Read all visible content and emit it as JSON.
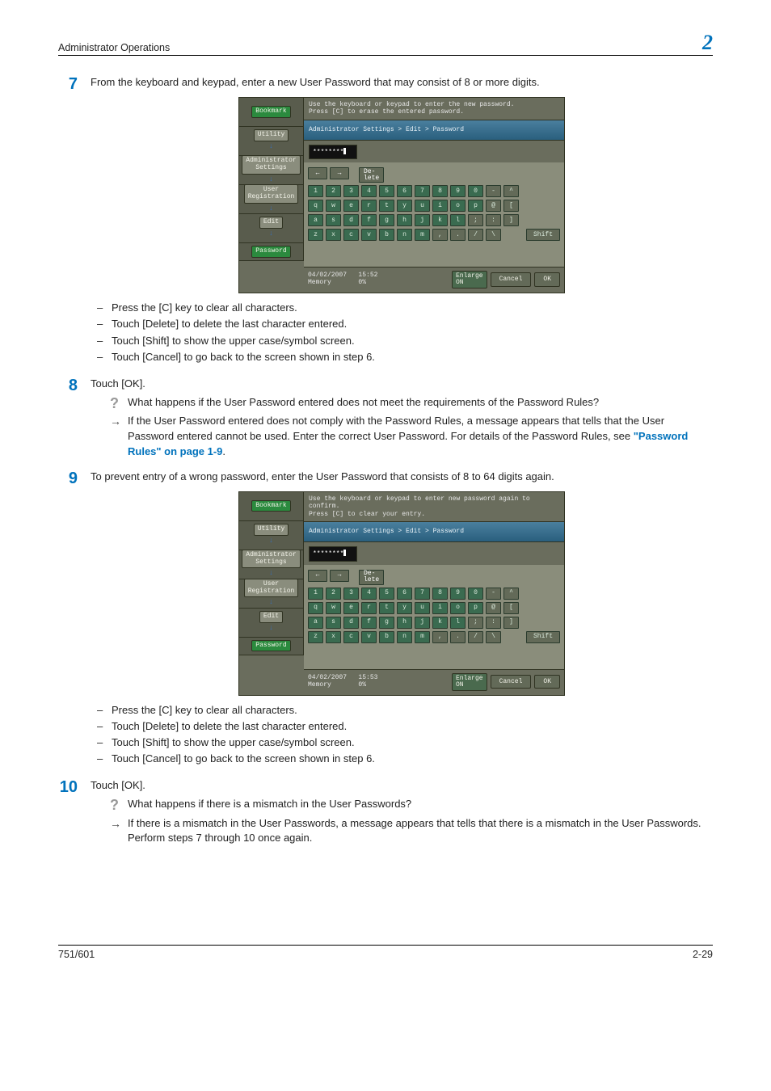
{
  "header": {
    "title": "Administrator Operations",
    "chapter": "2"
  },
  "footer": {
    "left": "751/601",
    "right": "2-29"
  },
  "steps": {
    "s7": {
      "num": "7",
      "text": "From the keyboard and keypad, enter a new User Password that may consist of 8 or more digits.",
      "bullets": [
        "Press the [C] key to clear all characters.",
        "Touch [Delete] to delete the last character entered.",
        "Touch [Shift] to show the upper case/symbol screen.",
        "Touch [Cancel] to go back to the screen shown in step 6."
      ]
    },
    "s8": {
      "num": "8",
      "text": "Touch [OK].",
      "q": "What happens if the User Password entered does not meet the requirements of the Password Rules?",
      "a_prefix": "If the User Password entered does not comply with the Password Rules, a message appears that tells that the User Password entered cannot be used. Enter the correct User Password. For details of the Password Rules, see ",
      "a_link": "\"Password Rules\" on page 1-9",
      "a_suffix": "."
    },
    "s9": {
      "num": "9",
      "text": "To prevent entry of a wrong password, enter the User Password that consists of 8 to 64 digits again.",
      "bullets": [
        "Press the [C] key to clear all characters.",
        "Touch [Delete] to delete the last character entered.",
        "Touch [Shift] to show the upper case/symbol screen.",
        "Touch [Cancel] to go back to the screen shown in step 6."
      ]
    },
    "s10": {
      "num": "10",
      "text": "Touch [OK].",
      "q": "What happens if there is a mismatch in the User Passwords?",
      "a": "If there is a mismatch in the User Passwords, a message appears that tells that there is a mismatch in the User Passwords. Perform steps 7 through 10 once again."
    }
  },
  "screen": {
    "prompt1_a": "Use the keyboard or keypad to enter the new password.",
    "prompt1_b": "Press [C] to erase the entered password.",
    "prompt2_a": "Use the keyboard or keypad to enter new password again to confirm.",
    "prompt2_b": "Press [C] to clear your entry.",
    "crumb": "Administrator Settings > Edit > Password",
    "masked": "********",
    "side": {
      "bookmark": "Bookmark",
      "utility": "Utility",
      "admin": "Administrator\nSettings",
      "userreg": "User\nRegistration",
      "edit": "Edit",
      "password": "Password"
    },
    "kbd": {
      "left_arrow": "←",
      "right_arrow": "→",
      "delete": "De-\nlete",
      "row1": [
        "1",
        "2",
        "3",
        "4",
        "5",
        "6",
        "7",
        "8",
        "9",
        "0",
        "-",
        "^"
      ],
      "row2": [
        "q",
        "w",
        "e",
        "r",
        "t",
        "y",
        "u",
        "i",
        "o",
        "p",
        "@",
        "["
      ],
      "row3": [
        "a",
        "s",
        "d",
        "f",
        "g",
        "h",
        "j",
        "k",
        "l",
        ";",
        ":",
        "]"
      ],
      "row4": [
        "z",
        "x",
        "c",
        "v",
        "b",
        "n",
        "m",
        ",",
        ".",
        "/",
        "\\"
      ],
      "shift": "Shift"
    },
    "status": {
      "date1": "04/02/2007",
      "time1": "15:52",
      "date2": "04/02/2007",
      "time2": "15:53",
      "mem": "Memory",
      "mem_val": "0%",
      "enlarge": "Enlarge\nON",
      "cancel": "Cancel",
      "ok": "OK"
    }
  }
}
